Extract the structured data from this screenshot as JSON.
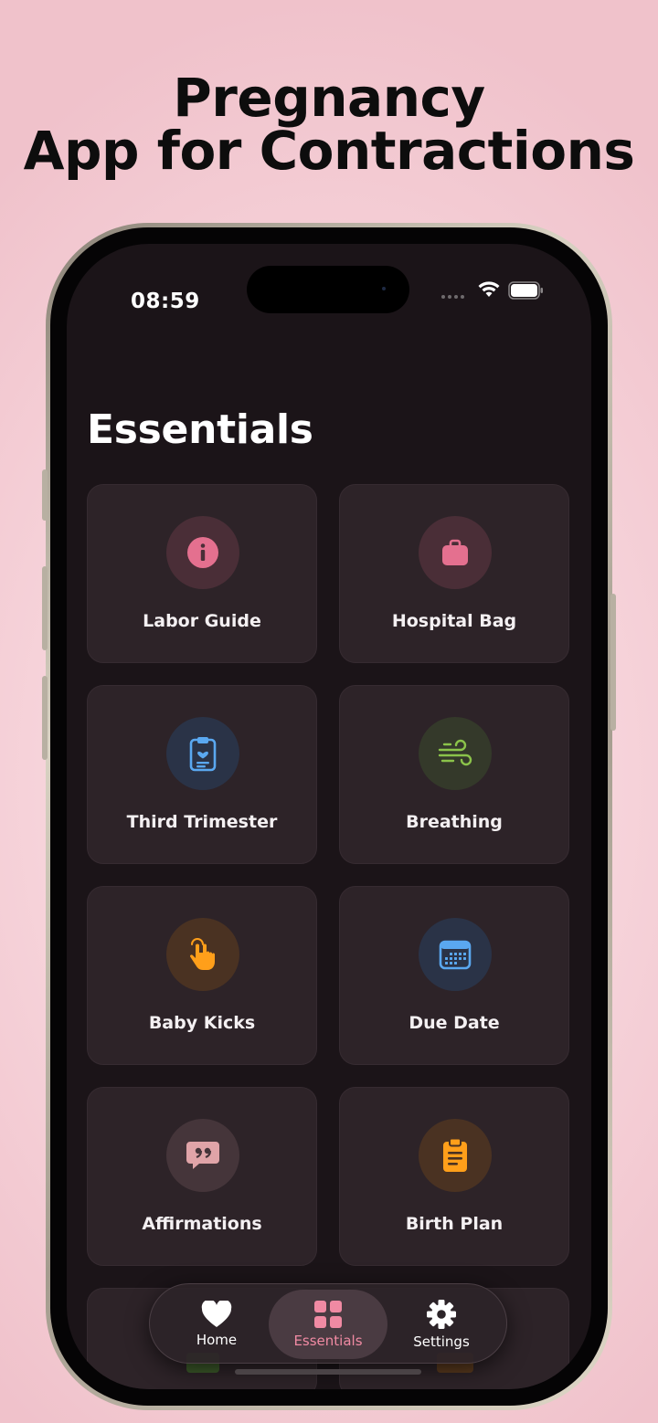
{
  "headline": {
    "line1": "Pregnancy",
    "line2": "App for Contractions"
  },
  "status_bar": {
    "time": "08:59",
    "icons": [
      "signal-dots-icon",
      "wifi-icon",
      "battery-icon"
    ]
  },
  "page": {
    "title": "Essentials"
  },
  "cards": [
    {
      "label": "Labor Guide",
      "icon": "info-icon",
      "color": "#e4708f"
    },
    {
      "label": "Hospital Bag",
      "icon": "bag-icon",
      "color": "#e4708f"
    },
    {
      "label": "Third Trimester",
      "icon": "clipboard-heart-icon",
      "color": "#5aa8f0"
    },
    {
      "label": "Breathing",
      "icon": "wind-icon",
      "color": "#8bc34a"
    },
    {
      "label": "Baby Kicks",
      "icon": "tap-hand-icon",
      "color": "#ff9f1a"
    },
    {
      "label": "Due Date",
      "icon": "calendar-icon",
      "color": "#5aa8f0"
    },
    {
      "label": "Affirmations",
      "icon": "quote-bubble-icon",
      "color": "#e0a4a8"
    },
    {
      "label": "Birth Plan",
      "icon": "clipboard-list-icon",
      "color": "#ff9f1a"
    }
  ],
  "tab_bar": {
    "tabs": [
      {
        "label": "Home",
        "icon": "heart-icon",
        "active": false
      },
      {
        "label": "Essentials",
        "icon": "grid-icon",
        "active": true
      },
      {
        "label": "Settings",
        "icon": "gear-icon",
        "active": false
      }
    ],
    "active_color": "#f08aa3"
  }
}
